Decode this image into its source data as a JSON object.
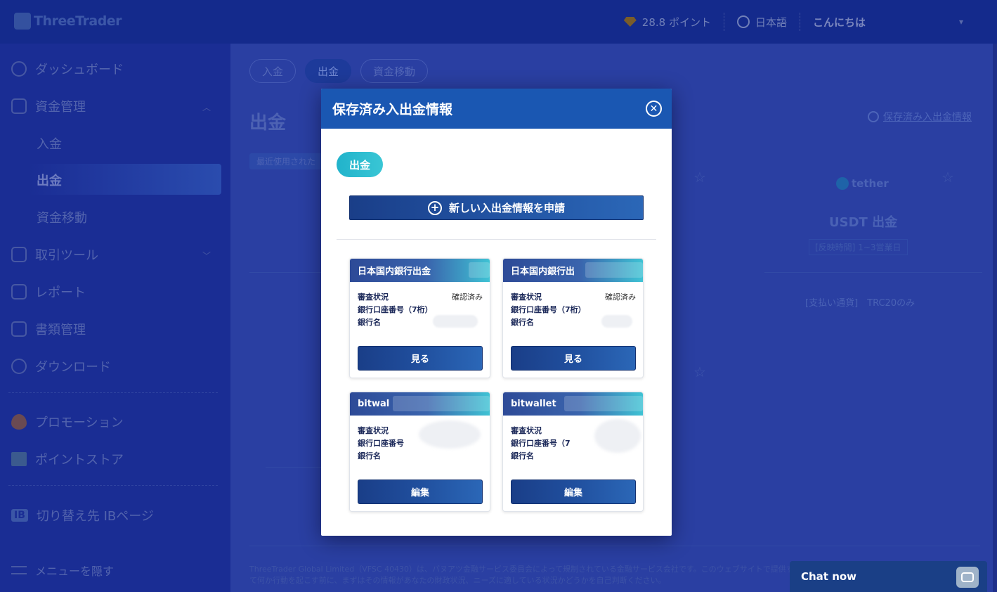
{
  "app": {
    "logo_text": "ThreeTrader"
  },
  "header": {
    "points": "28.8 ポイント",
    "language": "日本語",
    "greeting": "こんにちは"
  },
  "sidebar": {
    "dashboard": "ダッシュボード",
    "funds": "資金管理",
    "deposit": "入金",
    "withdraw": "出金",
    "transfer": "資金移動",
    "trading_tools": "取引ツール",
    "reports": "レポート",
    "documents": "書類管理",
    "downloads": "ダウンロード",
    "promotions": "プロモーション",
    "point_store": "ポイントストア",
    "ib_badge": "IB",
    "ib_switch": "切り替え先 IBページ",
    "hide_menu": "メニューを隠す"
  },
  "main": {
    "tabs": [
      {
        "label": "入金"
      },
      {
        "label": "出金"
      },
      {
        "label": "資金移動"
      }
    ],
    "page_title": "出金",
    "saved_link": "保存済み入出金情報",
    "recent_tag": "最近使用された",
    "tether_label": "tether",
    "usdt_title": "USDT 出金",
    "usdt_time": "[反映時間] 1~3営業日",
    "usdt_payment": "[支払い通貨]　TRC20のみ",
    "footer": "ThreeTrader Global Limited（VFSC 40430）は、バヌアツ金融サービス委員会によって規制されている金融サービス会社です。このウェブサイトで提供する情報はでありません。ウェブサイトの情報に基づいて何か行動を起こす前に、まずはその情報があなたの財政状況、ニーズに適している状況かどうかを自己判断ください。"
  },
  "modal": {
    "title": "保存済み入出金情報",
    "tab": "出金",
    "new_button": "新しい入出金情報を申請",
    "cards": [
      {
        "title": "日本国内銀行出金",
        "status_label": "審査状況",
        "status_value": "確認済み",
        "account_label": "銀行口座番号（7桁）",
        "bank_label": "銀行名",
        "button": "見る"
      },
      {
        "title": "日本国内銀行出",
        "status_label": "審査状況",
        "status_value": "確認済み",
        "account_label": "銀行口座番号（7桁）",
        "bank_label": "銀行名",
        "button": "見る"
      },
      {
        "title": "bitwal",
        "status_label": "審査状況",
        "account_label": "銀行口座番号",
        "bank_label": "銀行名",
        "button": "編集"
      },
      {
        "title": "bitwallet",
        "status_label": "審査状況",
        "account_label": "銀行口座番号（7",
        "bank_label": "銀行名",
        "button": "編集"
      }
    ]
  },
  "chat": {
    "label": "Chat now"
  }
}
